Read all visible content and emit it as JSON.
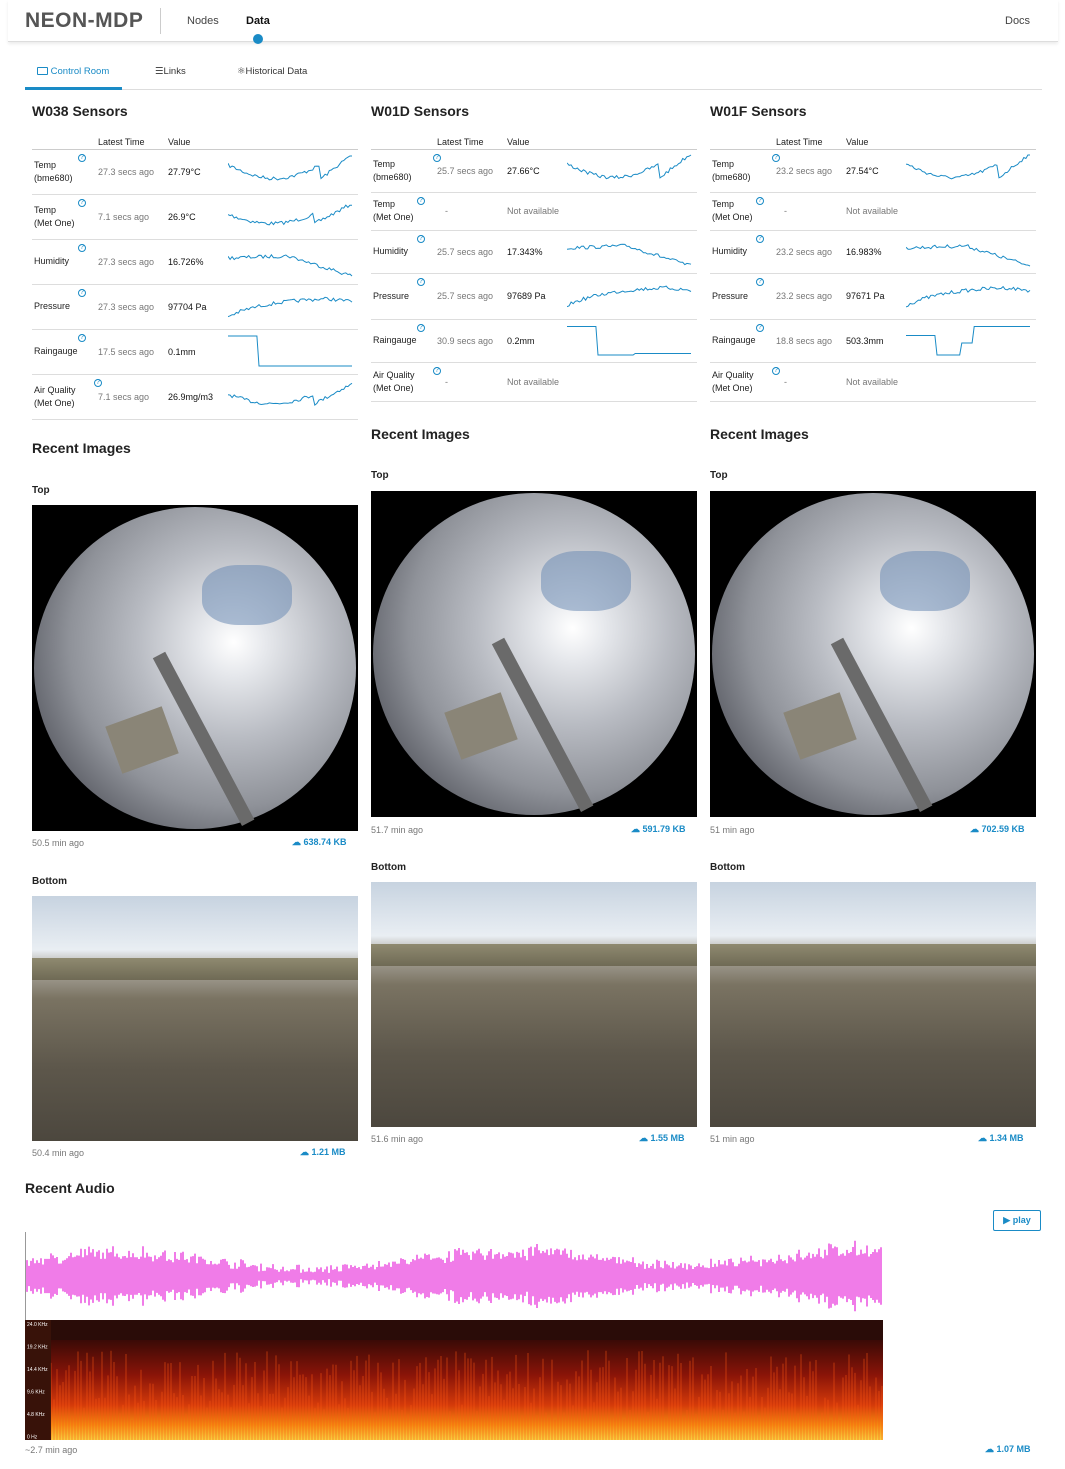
{
  "header": {
    "logo": "NEON-MDP",
    "nav": [
      "Nodes",
      "Data"
    ],
    "docs": "Docs",
    "active": "Data"
  },
  "tabs": [
    {
      "label": "Control Room",
      "icon": "monitor-icon",
      "active": true
    },
    {
      "label": "Links",
      "icon": "list-icon"
    },
    {
      "label": "Historical Data",
      "icon": "fire-icon"
    }
  ],
  "nodes": [
    {
      "title": "W038 Sensors",
      "cols": [
        "Latest Time",
        "Value"
      ],
      "rows": [
        {
          "name1": "Temp",
          "name2": "(bme680)",
          "time": "27.3 secs ago",
          "value": "27.79°C"
        },
        {
          "name1": "Temp",
          "name2": "(Met One)",
          "time": "7.1 secs ago",
          "value": "26.9°C"
        },
        {
          "name1": "Humidity",
          "name2": "",
          "time": "27.3 secs ago",
          "value": "16.726%"
        },
        {
          "name1": "Pressure",
          "name2": "",
          "time": "27.3 secs ago",
          "value": "97704 Pa"
        },
        {
          "name1": "Raingauge",
          "name2": "",
          "time": "17.5 secs ago",
          "value": "0.1mm"
        },
        {
          "name1": "Air Quality",
          "name2": "(Met One)",
          "time": "7.1 secs ago",
          "value": "26.9mg/m3"
        }
      ],
      "images_title": "Recent Images",
      "top_label": "Top",
      "top_time": "50.5 min ago",
      "top_size": "638.74 KB",
      "bottom_label": "Bottom",
      "bottom_time": "50.4 min ago",
      "bottom_size": "1.21 MB"
    },
    {
      "title": "W01D Sensors",
      "cols": [
        "Latest Time",
        "Value"
      ],
      "rows": [
        {
          "name1": "Temp (bme680)",
          "name2": "",
          "time": "25.7 secs ago",
          "value": "27.66°C"
        },
        {
          "name1": "Temp",
          "name2": "(Met One)",
          "time": "-",
          "value": "Not available"
        },
        {
          "name1": "Humidity",
          "name2": "",
          "time": "25.7 secs ago",
          "value": "17.343%"
        },
        {
          "name1": "Pressure",
          "name2": "",
          "time": "25.7 secs ago",
          "value": "97689 Pa"
        },
        {
          "name1": "Raingauge",
          "name2": "",
          "time": "30.9 secs ago",
          "value": "0.2mm"
        },
        {
          "name1": "Air Quality",
          "name2": "(Met One)",
          "time": "-",
          "value": "Not available"
        }
      ],
      "images_title": "Recent Images",
      "top_label": "Top",
      "top_time": "51.7 min ago",
      "top_size": "591.79 KB",
      "bottom_label": "Bottom",
      "bottom_time": "51.6 min ago",
      "bottom_size": "1.55 MB"
    },
    {
      "title": "W01F Sensors",
      "cols": [
        "Latest Time",
        "Value"
      ],
      "rows": [
        {
          "name1": "Temp (bme680)",
          "name2": "",
          "time": "23.2 secs ago",
          "value": "27.54°C"
        },
        {
          "name1": "Temp",
          "name2": "(Met One)",
          "time": "-",
          "value": "Not available"
        },
        {
          "name1": "Humidity",
          "name2": "",
          "time": "23.2 secs ago",
          "value": "16.983%"
        },
        {
          "name1": "Pressure",
          "name2": "",
          "time": "23.2 secs ago",
          "value": "97671 Pa"
        },
        {
          "name1": "Raingauge",
          "name2": "",
          "time": "18.8 secs ago",
          "value": "503.3mm"
        },
        {
          "name1": "Air Quality",
          "name2": "(Met One)",
          "time": "-",
          "value": "Not available"
        }
      ],
      "images_title": "Recent Images",
      "top_label": "Top",
      "top_time": "51 min ago",
      "top_size": "702.59 KB",
      "bottom_label": "Bottom",
      "bottom_time": "51 min ago",
      "bottom_size": "1.34 MB"
    }
  ],
  "audio": {
    "title": "Recent Audio",
    "play": "play",
    "time": "~2.7 min ago",
    "size": "1.07 MB",
    "freq_labels": [
      "24.0 KHz",
      "19.2 KHz",
      "14.4 KHz",
      "9.6 KHz",
      "4.8 KHz",
      "0 Hz"
    ],
    "wave_color": "#f07ce8"
  },
  "colors": {
    "accent": "#1a8bc6"
  }
}
